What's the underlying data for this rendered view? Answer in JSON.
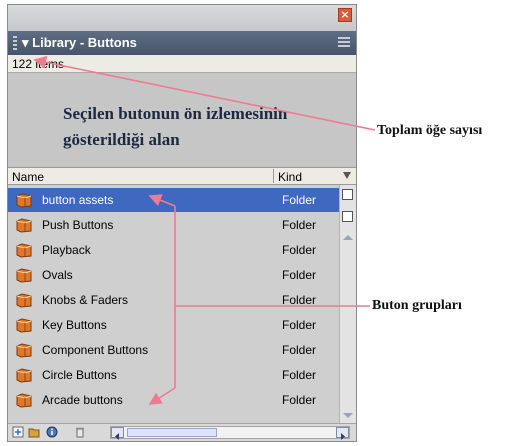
{
  "panel": {
    "title": "Library - Buttons",
    "item_count": "122 items",
    "preview_text": "Seçilen butonun ön izlemesinin gösterildiği alan",
    "close_label": "×"
  },
  "columns": {
    "name": "Name",
    "kind": "Kind"
  },
  "items": [
    {
      "name": "button assets",
      "kind": "Folder",
      "selected": true
    },
    {
      "name": "Push Buttons",
      "kind": "Folder"
    },
    {
      "name": "Playback",
      "kind": "Folder"
    },
    {
      "name": "Ovals",
      "kind": "Folder"
    },
    {
      "name": "Knobs & Faders",
      "kind": "Folder"
    },
    {
      "name": "Key Buttons",
      "kind": "Folder"
    },
    {
      "name": "Component Buttons",
      "kind": "Folder"
    },
    {
      "name": "Circle Buttons",
      "kind": "Folder"
    },
    {
      "name": "Arcade buttons",
      "kind": "Folder"
    }
  ],
  "annotations": {
    "total_items": "Toplam öğe sayısı",
    "button_groups": "Buton grupları"
  },
  "colors": {
    "selection": "#3f68c0",
    "title_bar": "#4f5e77",
    "annotation_arrow": "#f07a8e",
    "folder_icon": "#e0772a"
  },
  "icons": {
    "folder": "folder-icon",
    "close": "close-icon",
    "panel_menu": "panel-menu-icon",
    "new_symbol": "new-symbol-icon",
    "new_folder": "new-folder-icon",
    "properties": "properties-icon",
    "delete": "trash-icon"
  }
}
